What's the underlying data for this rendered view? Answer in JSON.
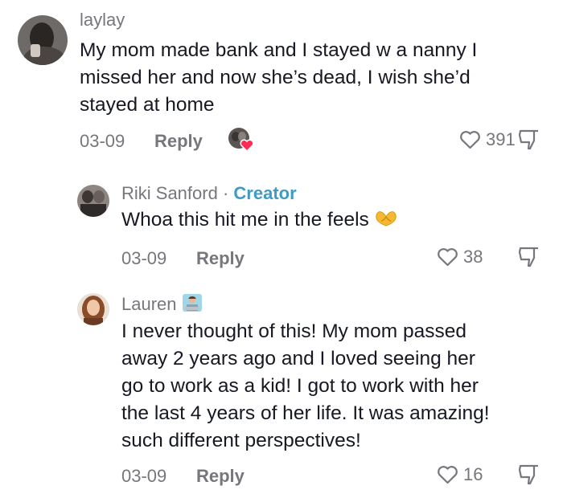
{
  "comments": [
    {
      "username": "laylay",
      "lines": [
        "My mom made bank and I stayed w a nanny I",
        "missed her and now she’s dead, I wish she’d",
        "stayed at home"
      ],
      "date": "03-09",
      "reply_label": "Reply",
      "likes": "391",
      "creator_liked": true
    },
    {
      "username": "Riki Sanford",
      "separator": "·",
      "badge": "Creator",
      "lines": [
        "Whoa this hit me in the feels"
      ],
      "emoji": "heart-hands-emoji",
      "date": "03-09",
      "reply_label": "Reply",
      "likes": "38"
    },
    {
      "username": "Lauren",
      "name_emoji": "person-at-laptop-emoji",
      "lines": [
        "I never thought of this! My mom passed",
        "away 2 years ago and I loved seeing her",
        "go to work as a kid! I got to work with her",
        "the last 4 years of her life. It was amazing!",
        "such different perspectives!"
      ],
      "date": "03-09",
      "reply_label": "Reply",
      "likes": "16"
    }
  ],
  "colors": {
    "text": "#161823",
    "muted": "#76777d",
    "creator": "#3f9ac4",
    "heart_red": "#fe2c55"
  }
}
